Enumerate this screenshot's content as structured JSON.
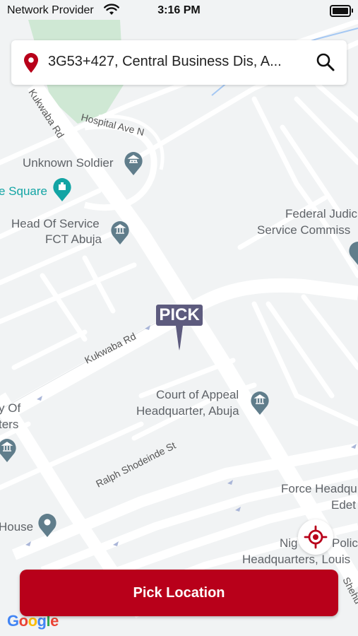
{
  "status_bar": {
    "carrier": "Network Provider",
    "time": "3:16 PM"
  },
  "search": {
    "address": "3G53+427, Central Business Dis, A..."
  },
  "map": {
    "streets": {
      "kukwaba_rd_upper": "Kukwaba Rd",
      "hospital_ave": "Hospital Ave N",
      "kukwaba_rd_lower": "Kukwaba Rd",
      "ralph_shodeinde": "Ralph Shodeinde St",
      "shehu": "Shehu"
    },
    "pois": {
      "unknown_soldier": "Unknown Soldier",
      "square": "e Square",
      "head_of_service_1": "Head Of Service",
      "head_of_service_2": "FCT Abuja",
      "federal_judic_1": "Federal Judic",
      "federal_judic_2": "Service Commiss",
      "court_of_appeal_1": "Court of Appeal",
      "court_of_appeal_2": "Headquarter, Abuja",
      "y_of": "y Of",
      "ters": "ters",
      "force_hq_1": "Force Headqu",
      "force_hq_2": "Edet",
      "nig_police_1": "Nig",
      "nig_police_2": "Polic",
      "nig_police_3": "Headquarters, Louis",
      "house": "House"
    }
  },
  "marker": {
    "label": "PICK"
  },
  "pick_button": {
    "label": "Pick Location"
  },
  "brand": {
    "logo_text": "Google"
  },
  "colors": {
    "primary": "#b8001a",
    "marker": "#5d5b7e",
    "map_bg": "#f1f3f4",
    "road": "#ffffff",
    "park": "#cfe8d4",
    "poi_icon": "#607d8b",
    "poi_teal": "#12a4a4"
  }
}
